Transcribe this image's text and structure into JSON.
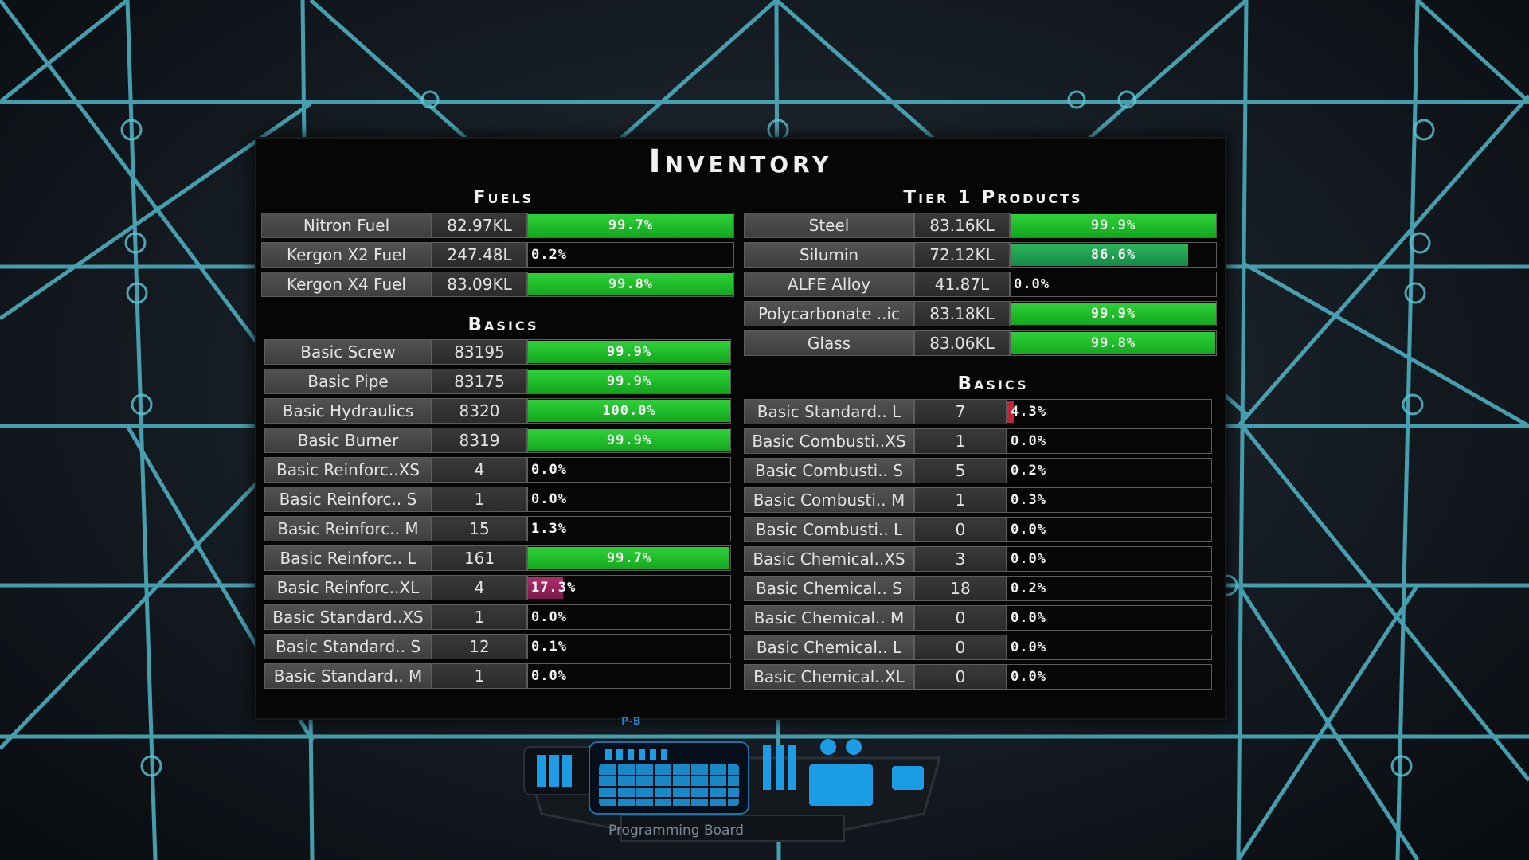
{
  "title": "Inventory",
  "colors": {
    "bar_full": "#1fbf2a",
    "bar_partial": "#23a657",
    "bar_low_red": "#c0253a",
    "bar_mid_magenta": "#a02a64",
    "scaffold": "#4fb7c7"
  },
  "fuels": {
    "heading": "Fuels",
    "items": [
      {
        "name": "Nitron Fuel",
        "qty": "82.97KL",
        "pct": "99.7%",
        "fill": 0.997
      },
      {
        "name": "Kergon X2 Fuel",
        "qty": "247.48L",
        "pct": "0.2%",
        "fill": 0.002
      },
      {
        "name": "Kergon X4 Fuel",
        "qty": "83.09KL",
        "pct": "99.8%",
        "fill": 0.998
      }
    ]
  },
  "tier1": {
    "heading": "Tier 1 Products",
    "items": [
      {
        "name": "Steel",
        "qty": "83.16KL",
        "pct": "99.9%",
        "fill": 0.999
      },
      {
        "name": "Silumin",
        "qty": "72.12KL",
        "pct": "86.6%",
        "fill": 0.866
      },
      {
        "name": "ALFE Alloy",
        "qty": "41.87L",
        "pct": "0.0%",
        "fill": 0.0
      },
      {
        "name": "Polycarbonate ..ic",
        "qty": "83.18KL",
        "pct": "99.9%",
        "fill": 0.999
      },
      {
        "name": "Glass",
        "qty": "83.06KL",
        "pct": "99.8%",
        "fill": 0.998
      }
    ]
  },
  "basics_left": {
    "heading": "Basics",
    "items": [
      {
        "name": "Basic Screw",
        "qty": "83195",
        "pct": "99.9%",
        "fill": 0.999
      },
      {
        "name": "Basic Pipe",
        "qty": "83175",
        "pct": "99.9%",
        "fill": 0.999
      },
      {
        "name": "Basic Hydraulics",
        "qty": "8320",
        "pct": "100.0%",
        "fill": 1.0
      },
      {
        "name": "Basic Burner",
        "qty": "8319",
        "pct": "99.9%",
        "fill": 0.999
      },
      {
        "name": "Basic Reinforc..XS",
        "qty": "4",
        "pct": "0.0%",
        "fill": 0.0
      },
      {
        "name": "Basic Reinforc.. S",
        "qty": "1",
        "pct": "0.0%",
        "fill": 0.0
      },
      {
        "name": "Basic Reinforc.. M",
        "qty": "15",
        "pct": "1.3%",
        "fill": 0.013
      },
      {
        "name": "Basic Reinforc.. L",
        "qty": "161",
        "pct": "99.7%",
        "fill": 0.997
      },
      {
        "name": "Basic Reinforc..XL",
        "qty": "4",
        "pct": "17.3%",
        "fill": 0.173
      },
      {
        "name": "Basic Standard..XS",
        "qty": "1",
        "pct": "0.0%",
        "fill": 0.0
      },
      {
        "name": "Basic Standard.. S",
        "qty": "12",
        "pct": "0.1%",
        "fill": 0.001
      },
      {
        "name": "Basic Standard.. M",
        "qty": "1",
        "pct": "0.0%",
        "fill": 0.0
      }
    ]
  },
  "basics_right": {
    "heading": "Basics",
    "items": [
      {
        "name": "Basic Standard.. L",
        "qty": "7",
        "pct": "4.3%",
        "fill": 0.043
      },
      {
        "name": "Basic Combusti..XS",
        "qty": "1",
        "pct": "0.0%",
        "fill": 0.0
      },
      {
        "name": "Basic Combusti.. S",
        "qty": "5",
        "pct": "0.2%",
        "fill": 0.002
      },
      {
        "name": "Basic Combusti.. M",
        "qty": "1",
        "pct": "0.3%",
        "fill": 0.003
      },
      {
        "name": "Basic Combusti.. L",
        "qty": "0",
        "pct": "0.0%",
        "fill": 0.0
      },
      {
        "name": "Basic Chemical..XS",
        "qty": "3",
        "pct": "0.0%",
        "fill": 0.0
      },
      {
        "name": "Basic Chemical.. S",
        "qty": "18",
        "pct": "0.2%",
        "fill": 0.002
      },
      {
        "name": "Basic Chemical.. M",
        "qty": "0",
        "pct": "0.0%",
        "fill": 0.0
      },
      {
        "name": "Basic Chemical.. L",
        "qty": "0",
        "pct": "0.0%",
        "fill": 0.0
      },
      {
        "name": "Basic Chemical..XL",
        "qty": "0",
        "pct": "0.0%",
        "fill": 0.0
      }
    ]
  },
  "board": {
    "label": "Programming Board",
    "id": "P-B"
  }
}
